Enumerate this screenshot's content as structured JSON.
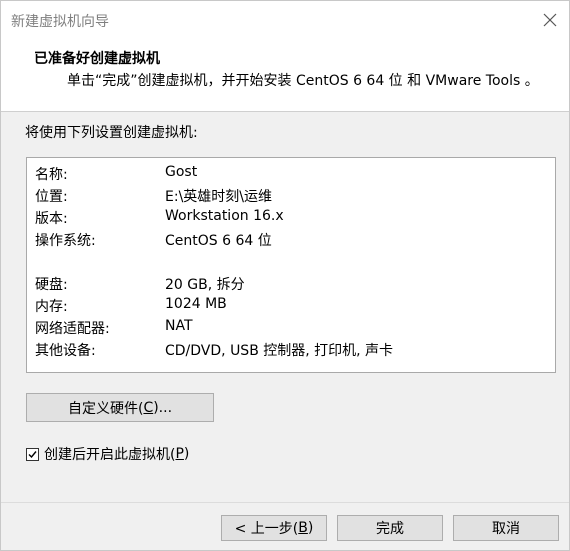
{
  "window": {
    "title": "新建虚拟机向导"
  },
  "header": {
    "title": "已准备好创建虚拟机",
    "description": "单击“完成”创建虚拟机，并开始安装 CentOS 6 64 位 和 VMware Tools 。"
  },
  "summary": {
    "intro": "将使用下列设置创建虚拟机:",
    "rows": [
      {
        "key": "名称:",
        "value": "Gost"
      },
      {
        "key": "位置:",
        "value": "E:\\英雄时刻\\运维"
      },
      {
        "key": "版本:",
        "value": "Workstation 16.x"
      },
      {
        "key": "操作系统:",
        "value": "CentOS 6 64 位"
      },
      {
        "key": "硬盘:",
        "value": "20 GB, 拆分"
      },
      {
        "key": "内存:",
        "value": "1024 MB"
      },
      {
        "key": "网络适配器:",
        "value": "NAT"
      },
      {
        "key": "其他设备:",
        "value": "CD/DVD, USB 控制器, 打印机, 声卡"
      }
    ]
  },
  "buttons": {
    "customize_hardware": {
      "label": "自定义硬件(",
      "mnemonic": "C",
      "suffix": ")..."
    },
    "back": {
      "label": "< 上一步(",
      "mnemonic": "B",
      "suffix": ")"
    },
    "finish": "完成",
    "cancel": "取消"
  },
  "power_on_checkbox": {
    "label": "创建后开启此虚拟机(",
    "mnemonic": "P",
    "suffix": ")",
    "checked": true
  },
  "icons": {
    "close": "close-icon",
    "check": "checkmark-icon"
  }
}
